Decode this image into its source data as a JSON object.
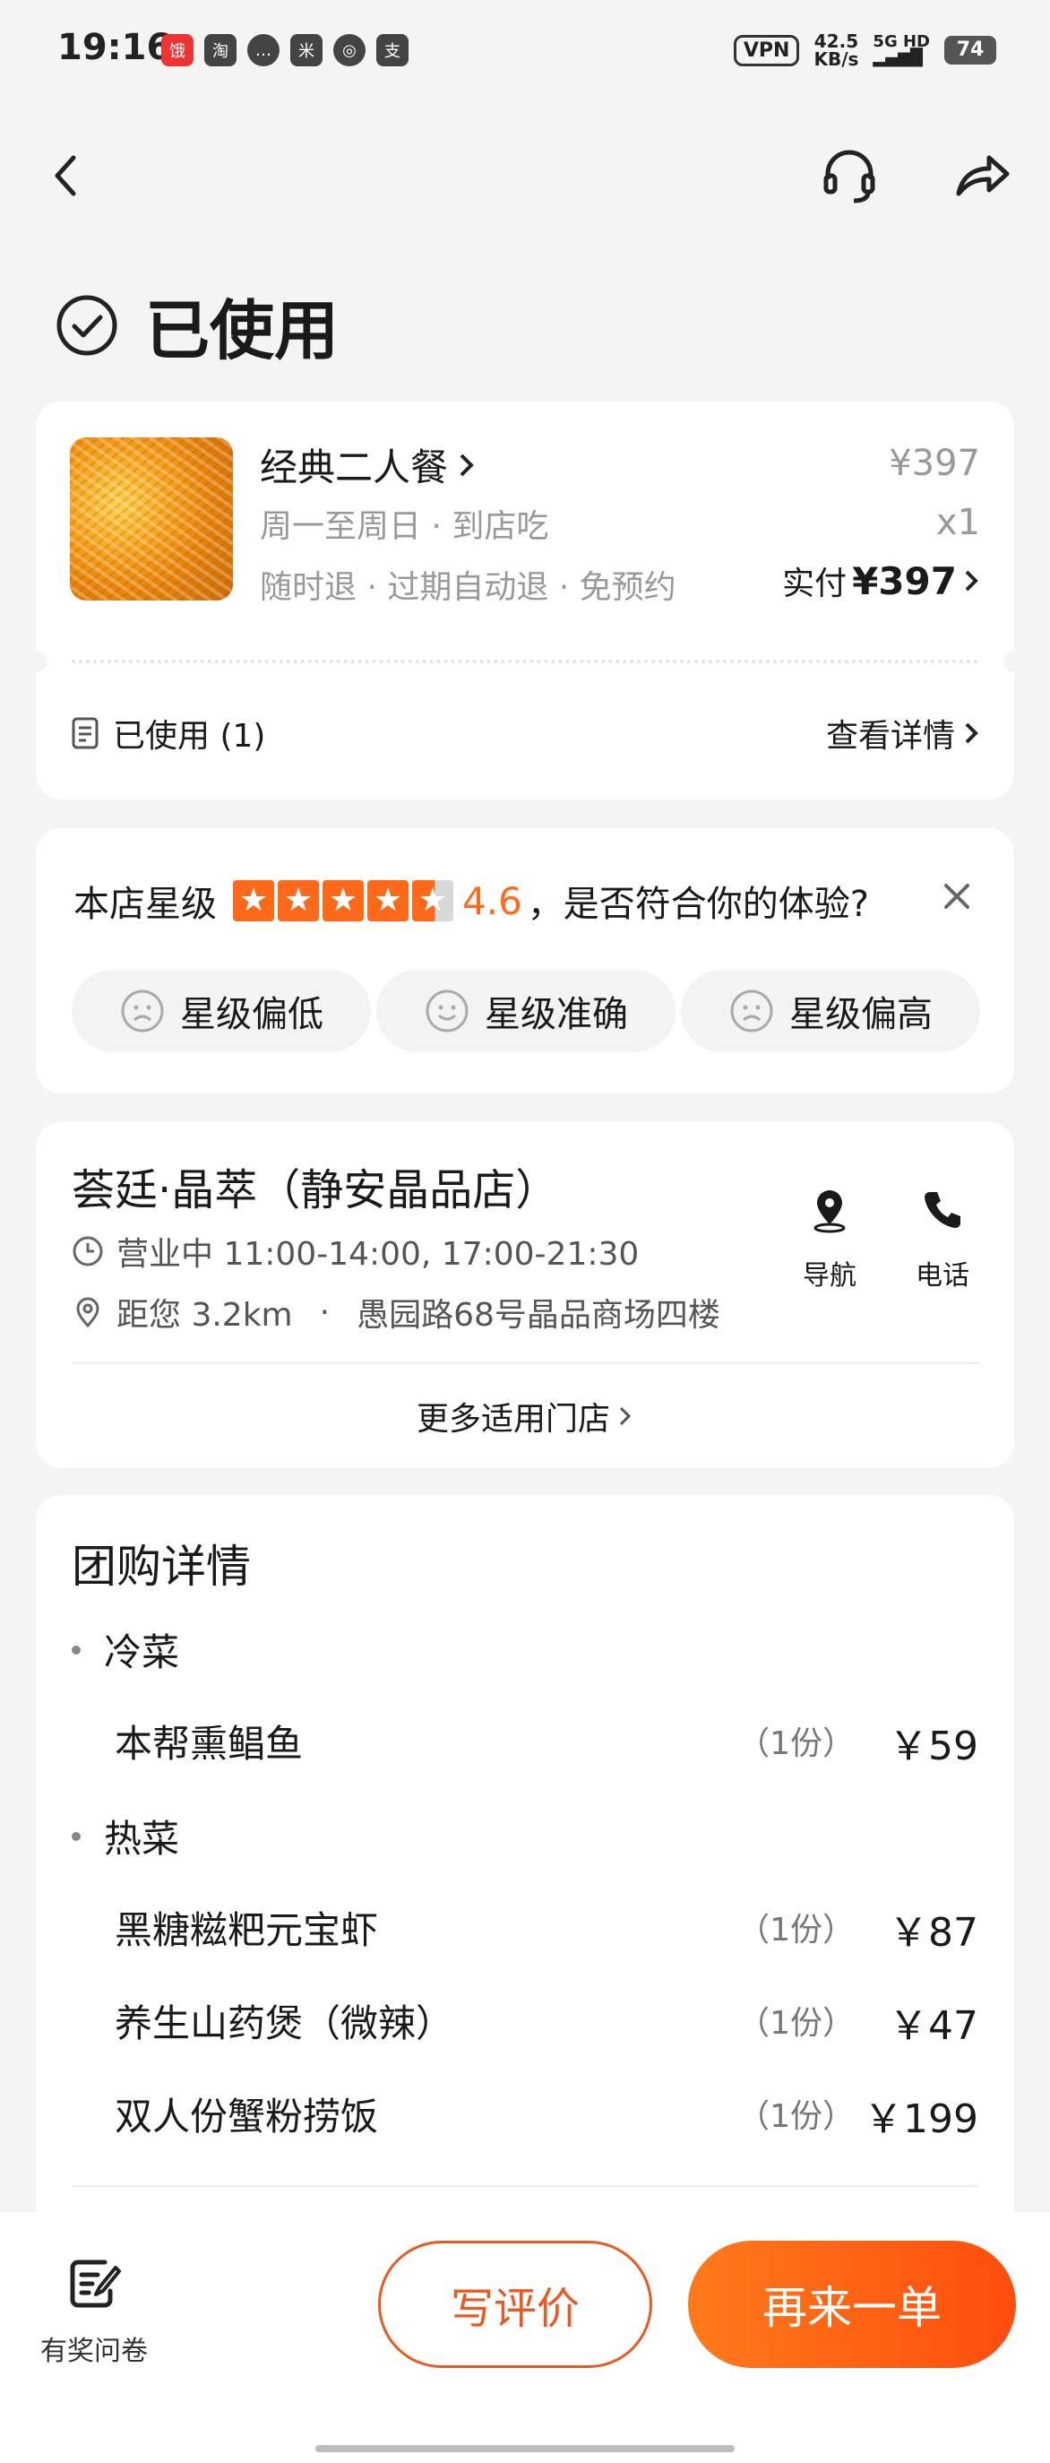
{
  "status_bar": {
    "time": "19:16",
    "app_icons": [
      "饿了么",
      "淘",
      "消息",
      "米",
      "相机",
      "支"
    ],
    "vpn": "VPN",
    "speed_value": "42.5",
    "speed_unit": "KB/s",
    "network": "5G HD",
    "battery": "74"
  },
  "page": {
    "title": "已使用"
  },
  "order": {
    "name": "经典二人餐",
    "schedule": "周一至周日 · 到店吃",
    "tags": "随时退 · 过期自动退 · 免预约",
    "original_price": "¥397",
    "quantity": "x1",
    "paid_label": "实付",
    "paid_amount": "¥397",
    "used_status": "已使用 (1)",
    "details_link": "查看详情"
  },
  "rating": {
    "label": "本店星级",
    "stars": 4.6,
    "score": "4.6",
    "question": "，是否符合你的体验?",
    "options": [
      "星级偏低",
      "星级准确",
      "星级偏高"
    ]
  },
  "store": {
    "name": "荟廷·晶萃（静安晶品店）",
    "hours": "营业中 11:00-14:00, 17:00-21:30",
    "distance": "距您 3.2km",
    "address_sep": "·",
    "address": "愚园路68号晶品商场四楼",
    "nav_label": "导航",
    "phone_label": "电话",
    "more_stores": "更多适用门店"
  },
  "group_details": {
    "title": "团购详情",
    "categories": [
      {
        "name": "冷菜",
        "items": [
          {
            "name": "本帮熏鲳鱼",
            "count": "（1份）",
            "price": "￥59"
          }
        ]
      },
      {
        "name": "热菜",
        "items": [
          {
            "name": "黑糖糍粑元宝虾",
            "count": "（1份）",
            "price": "￥87"
          },
          {
            "name": "养生山药煲（微辣）",
            "count": "（1份）",
            "price": "￥47"
          },
          {
            "name": "双人份蟹粉捞饭",
            "count": "（1份）",
            "price": "￥199"
          }
        ]
      }
    ]
  },
  "bottom_bar": {
    "survey_label": "有奖问卷",
    "review_button": "写评价",
    "reorder_button": "再来一单"
  },
  "colors": {
    "accent": "#ff6a1a",
    "button_gradient_start": "#ff7a1a",
    "button_gradient_end": "#ff4d0f"
  }
}
